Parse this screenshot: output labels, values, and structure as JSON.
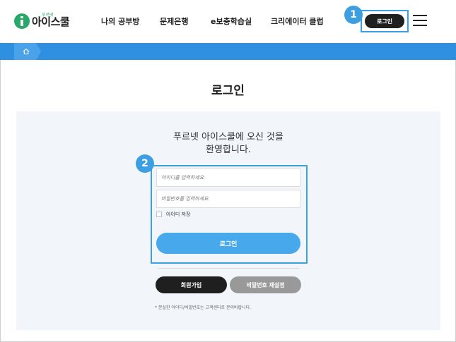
{
  "header": {
    "logo_sub": "푸르넷",
    "logo_text_main": "아이스쿨",
    "nav": [
      "나의 공부방",
      "문제은행",
      "e보충학습실",
      "크리에이터 클럽"
    ],
    "login_label": "로그인",
    "marker_1": "1"
  },
  "breadcrumb": {
    "home_icon": "home-icon"
  },
  "page": {
    "title": "로그인",
    "welcome_line1": "푸르넷 아이스쿨에 오신 것을",
    "welcome_line2": "환영합니다.",
    "marker_2": "2"
  },
  "form": {
    "id_placeholder": "아이디를 입력하세요.",
    "pw_placeholder": "비밀번호를 입력하세요.",
    "remember_label": "아이디 저장",
    "login_label": "로그인",
    "signup_label": "회원가입",
    "reset_label": "비밀번호 재설정",
    "notice": "* 분실한 아이디/비밀번호는 고객센터로 문의바랍니다."
  },
  "colors": {
    "accent_blue": "#2f8fe0",
    "button_blue": "#47a8ec",
    "brand_green": "#2aa86a",
    "dark": "#1f1f1f"
  }
}
